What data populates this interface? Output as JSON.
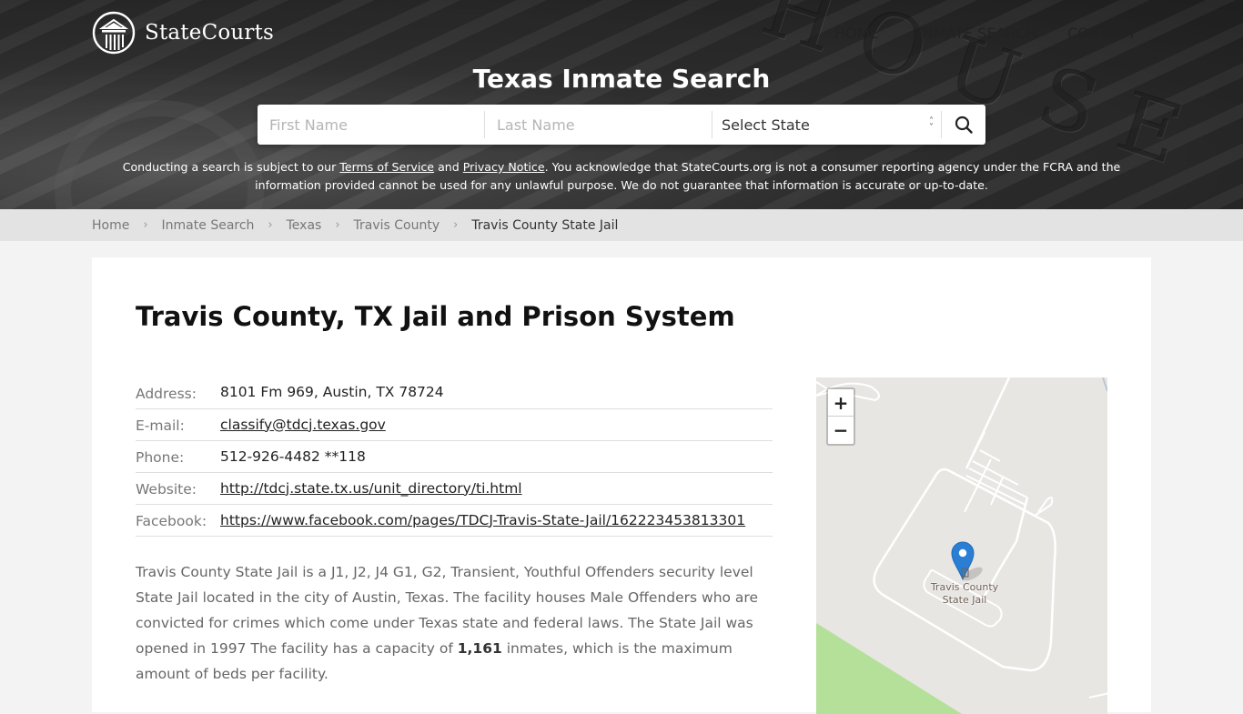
{
  "brand": {
    "name": "StateCourts"
  },
  "nav": {
    "items": [
      {
        "label": "HOME"
      },
      {
        "label": "INMATE SEARCH"
      },
      {
        "label": "CONTACT"
      }
    ]
  },
  "hero": {
    "title": "Texas Inmate Search",
    "search": {
      "first_name_placeholder": "First Name",
      "last_name_placeholder": "Last Name",
      "state_selected": "Select State",
      "submit_icon": "search-icon"
    },
    "disclaimer": {
      "part1": "Conducting a search is subject to our ",
      "terms_link": "Terms of Service",
      "part2": " and ",
      "privacy_link": "Privacy Notice",
      "part3": ". You acknowledge that StateCourts.org is not a consumer reporting agency under the FCRA and the information provided cannot be used for any unlawful purpose. We do not guarantee that information is accurate or up-to-date."
    }
  },
  "breadcrumb": {
    "items": [
      {
        "label": "Home"
      },
      {
        "label": "Inmate Search"
      },
      {
        "label": "Texas"
      },
      {
        "label": "Travis County"
      }
    ],
    "current": "Travis County State Jail"
  },
  "main": {
    "title": "Travis County, TX Jail and Prison System",
    "info": [
      {
        "label": "Address:",
        "value": "8101 Fm 969, Austin, TX 78724",
        "link": false
      },
      {
        "label": "E-mail:",
        "value": "classify@tdcj.texas.gov",
        "link": true
      },
      {
        "label": "Phone:",
        "value": "512-926-4482 **118",
        "link": false
      },
      {
        "label": "Website:",
        "value": "http://tdcj.state.tx.us/unit_directory/ti.html",
        "link": true
      },
      {
        "label": "Facebook:",
        "value": "https://www.facebook.com/pages/TDCJ-Travis-State-Jail/162223453813301",
        "link": true
      }
    ],
    "description": {
      "before": "Travis County State Jail is a J1, J2, J4 G1, G2, Transient, Youthful Offenders security level State Jail located in the city of Austin, Texas. The facility houses Male Offenders who are convicted for crimes which come under Texas state and federal laws. The State Jail was opened in 1997 The facility has a capacity of ",
      "capacity": "1,161",
      "after": " inmates, which is the maximum amount of beds per facility."
    }
  },
  "map": {
    "zoom_in": "+",
    "zoom_out": "−",
    "place_label_line1": "Travis County",
    "place_label_line2": "State Jail",
    "marker_color": "#2a7fd4",
    "park_color": "#b4e09a"
  }
}
